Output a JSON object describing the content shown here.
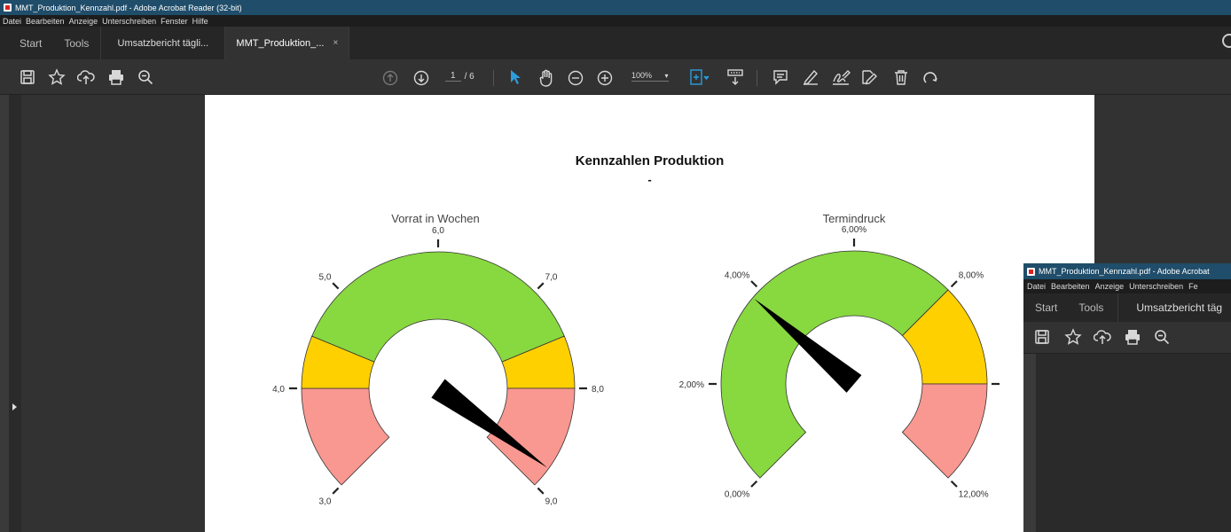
{
  "window": {
    "title": "MMT_Produktion_Kennzahl.pdf - Adobe Acrobat Reader (32-bit)",
    "menu": [
      "Datei",
      "Bearbeiten",
      "Anzeige",
      "Unterschreiben",
      "Fenster",
      "Hilfe"
    ]
  },
  "tabs": {
    "start": "Start",
    "tools": "Tools",
    "doc1": "Umsatzbericht tägli...",
    "doc2": "MMT_Produktion_...",
    "close": "×"
  },
  "toolbar": {
    "page_current": "1",
    "page_total": "/ 6",
    "zoom": "100%"
  },
  "document": {
    "title": "Kennzahlen Produktion",
    "subtitle": "-"
  },
  "chart_data": [
    {
      "type": "gauge",
      "title": "Vorrat in Wochen",
      "min": 3.0,
      "max": 9.0,
      "ticks": [
        "3,0",
        "4,0",
        "5,0",
        "6,0",
        "7,0",
        "8,0",
        "9,0"
      ],
      "bands": [
        {
          "from": 3.0,
          "to": 4.0,
          "color": "#f99890"
        },
        {
          "from": 4.0,
          "to": 4.5,
          "color": "#ffd000"
        },
        {
          "from": 4.5,
          "to": 7.5,
          "color": "#88d840"
        },
        {
          "from": 7.5,
          "to": 8.0,
          "color": "#ffd000"
        },
        {
          "from": 8.0,
          "to": 9.0,
          "color": "#f99890"
        }
      ],
      "value": 8.8
    },
    {
      "type": "gauge",
      "title": "Termindruck",
      "min": 0,
      "max": 12,
      "ticks": [
        "0,00%",
        "2,00%",
        "4,00%",
        "6,00%",
        "8,00%",
        "",
        "12,00%"
      ],
      "bands": [
        {
          "from": 0,
          "to": 8,
          "color": "#88d840"
        },
        {
          "from": 8,
          "to": 10,
          "color": "#ffd000"
        },
        {
          "from": 10,
          "to": 12,
          "color": "#f99890"
        }
      ],
      "value": 3.8
    }
  ],
  "second_window": {
    "title": "MMT_Produktion_Kennzahl.pdf - Adobe Acrobat",
    "menu": [
      "Datei",
      "Bearbeiten",
      "Anzeige",
      "Unterschreiben",
      "Fe"
    ],
    "tabs": [
      "Start",
      "Tools",
      "Umsatzbericht täg"
    ]
  },
  "colors": {
    "titlebar": "#1f4d6a",
    "accent": "#2d9cdb"
  }
}
